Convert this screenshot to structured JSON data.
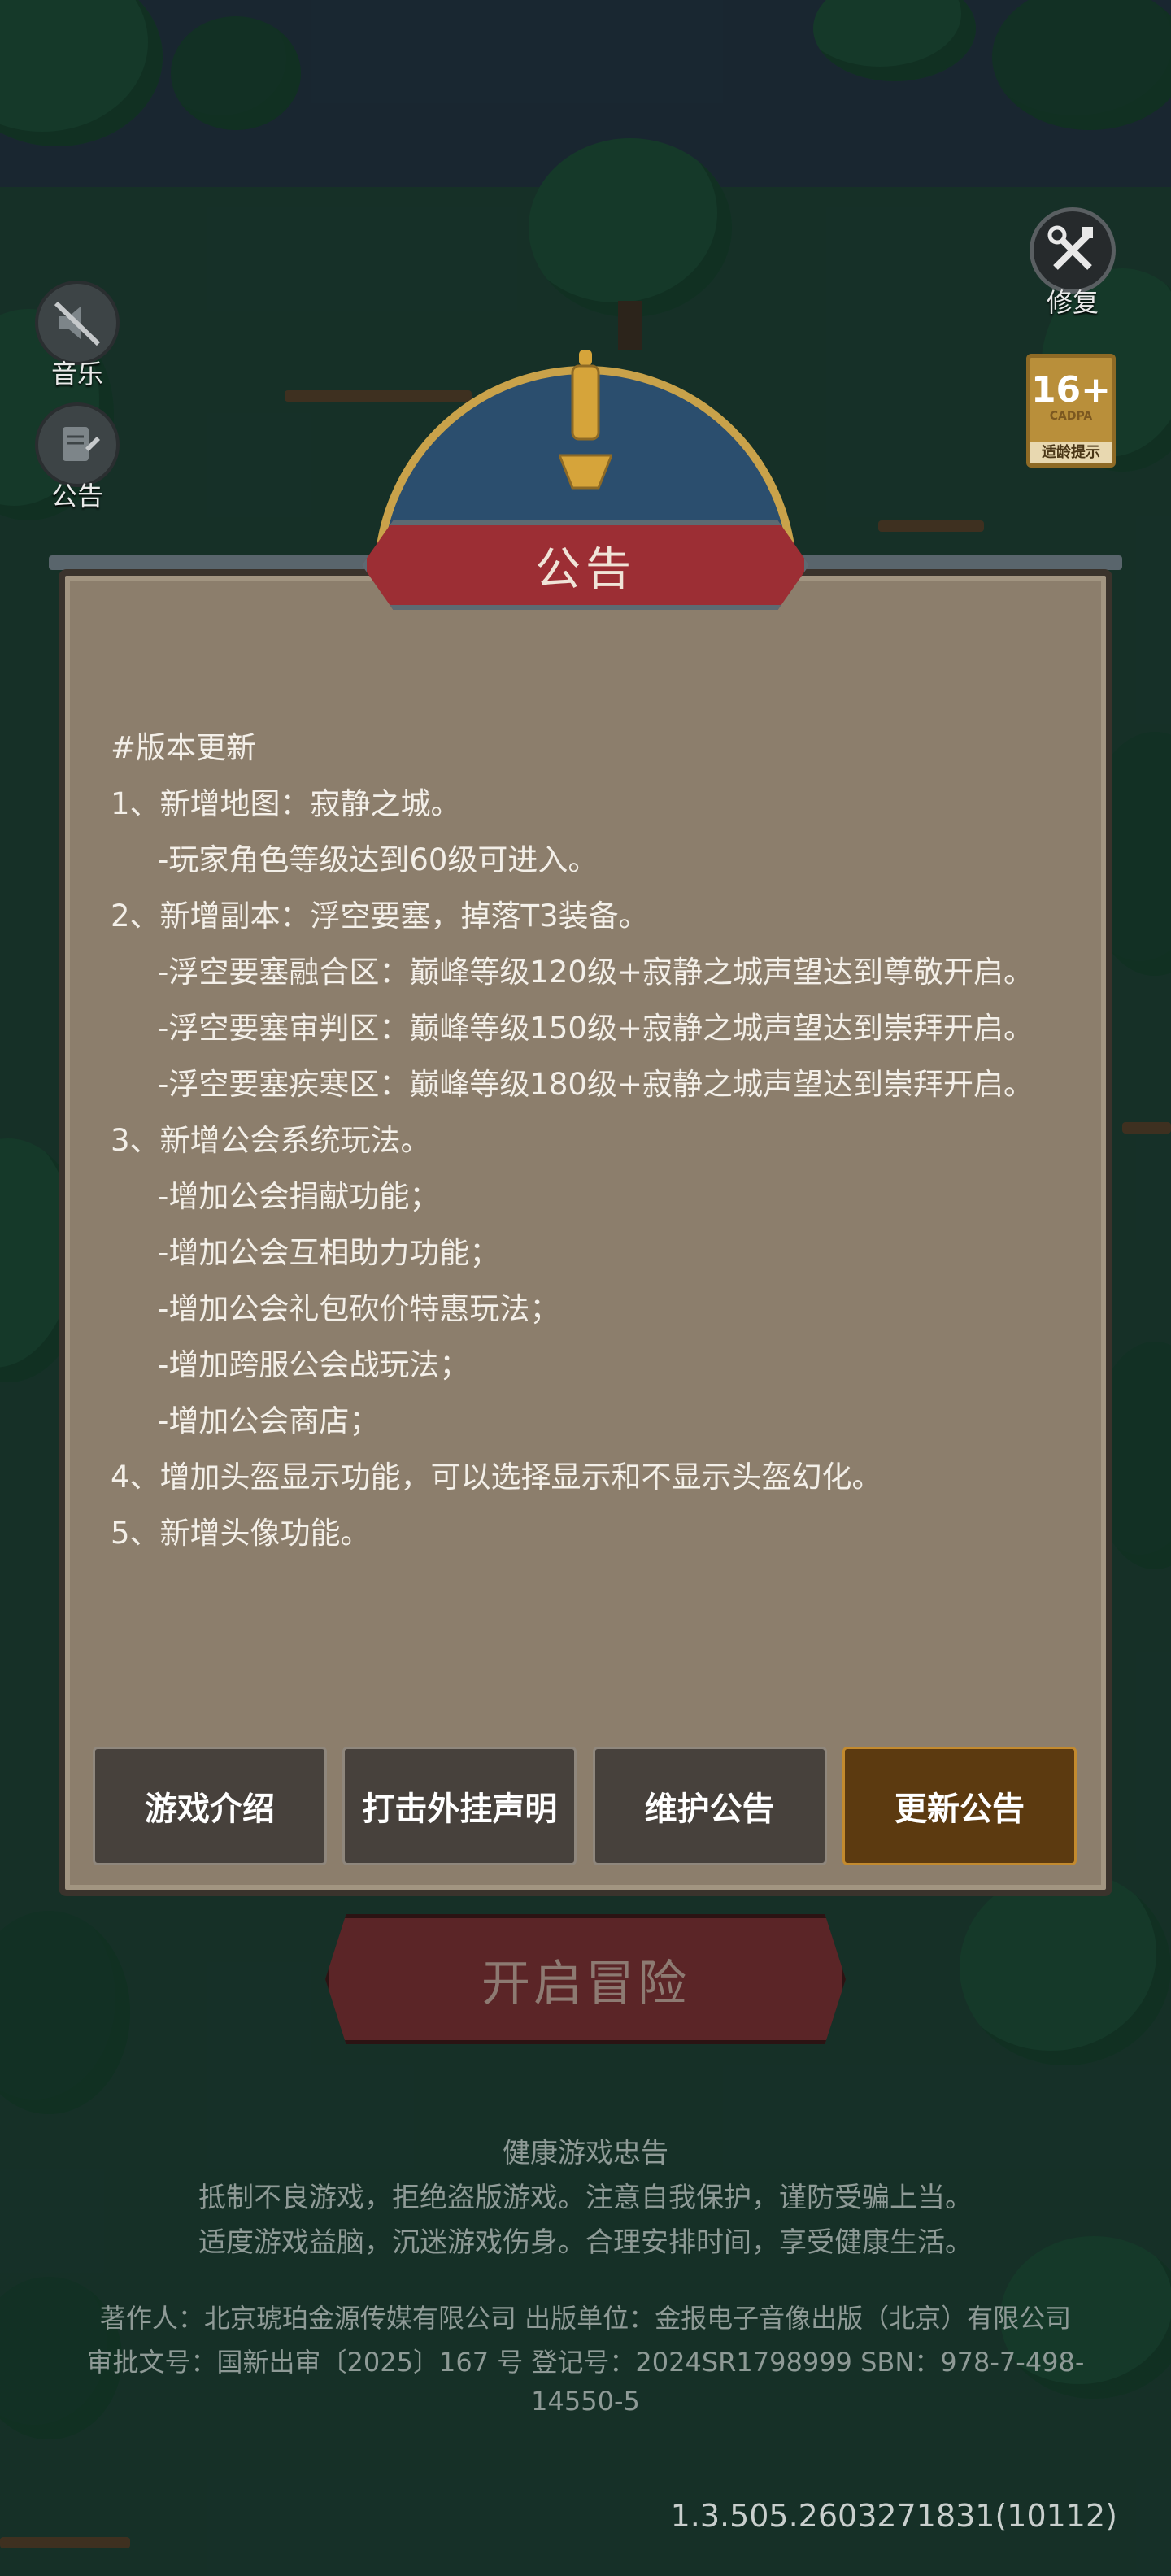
{
  "side_buttons": {
    "music_label": "音乐",
    "announcement_label": "公告",
    "repair_label": "修复"
  },
  "age_rating": {
    "age": "16+",
    "org": "CADPA",
    "tip": "适龄提示"
  },
  "dialog": {
    "title": "公告",
    "lines": [
      "#版本更新",
      "1、新增地图：寂静之城。",
      "-玩家角色等级达到60级可进入。",
      "2、新增副本：浮空要塞，掉落T3装备。",
      "-浮空要塞融合区：巅峰等级120级+寂静之城声望达到尊敬开启。",
      "-浮空要塞审判区：巅峰等级150级+寂静之城声望达到崇拜开启。",
      "-浮空要塞疾寒区：巅峰等级180级+寂静之城声望达到崇拜开启。",
      "3、新增公会系统玩法。",
      "-增加公会捐献功能；",
      "-增加公会互相助力功能；",
      "-增加公会礼包砍价特惠玩法；",
      "-增加跨服公会战玩法；",
      "-增加公会商店；",
      "4、增加头盔显示功能，可以选择显示和不显示头盔幻化。",
      "5、新增头像功能。"
    ],
    "tabs": [
      "游戏介绍",
      "打击外挂声明",
      "维护公告",
      "更新公告"
    ],
    "active_tab": "更新公告"
  },
  "start_button": "开启冒险",
  "health_notice": {
    "title": "健康游戏忠告",
    "line1": "抵制不良游戏，拒绝盗版游戏。注意自我保护，谨防受骗上当。",
    "line2": "适度游戏益脑，沉迷游戏伤身。合理安排时间，享受健康生活。"
  },
  "credits": {
    "line1": "著作人：北京琥珀金源传媒有限公司 出版单位：金报电子音像出版（北京）有限公司",
    "line2": "审批文号：国新出审〔2025〕167 号 登记号：2024SR1798999 SBN：978-7-498-",
    "line3": "14550-5"
  },
  "version": "1.3.505.2603271831(10112)"
}
